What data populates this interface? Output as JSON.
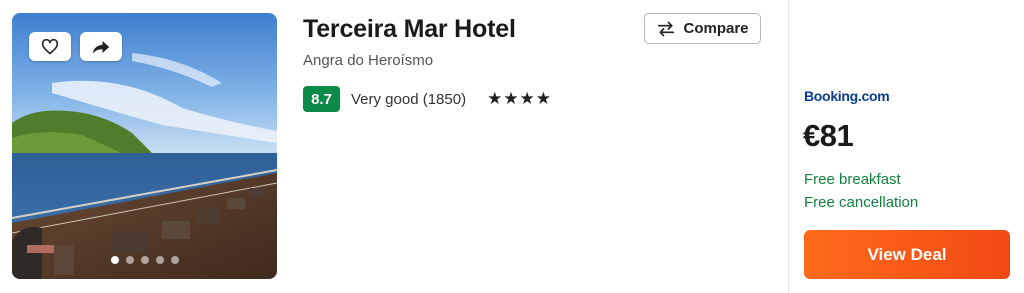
{
  "hotel": {
    "name": "Terceira Mar Hotel",
    "location": "Angra do Heroísmo",
    "score": "8.7",
    "rating_text": "Very good (1850)",
    "stars": "★★★★",
    "star_count": 4
  },
  "photo": {
    "favorite_icon": "heart-icon",
    "share_icon": "share-arrow-icon",
    "slide_count": 5,
    "active_slide": 1
  },
  "compare": {
    "icon": "swap-arrows-icon",
    "label": "Compare"
  },
  "offer": {
    "provider": "Booking.com",
    "price": "€81",
    "perks": [
      "Free breakfast",
      "Free cancellation"
    ],
    "cta_label": "View Deal"
  },
  "colors": {
    "score_bg": "#0b8a48",
    "perk_text": "#13823f",
    "provider_text": "#0b3d8c",
    "cta_start": "#ff6a1a",
    "cta_end": "#f04a14"
  }
}
